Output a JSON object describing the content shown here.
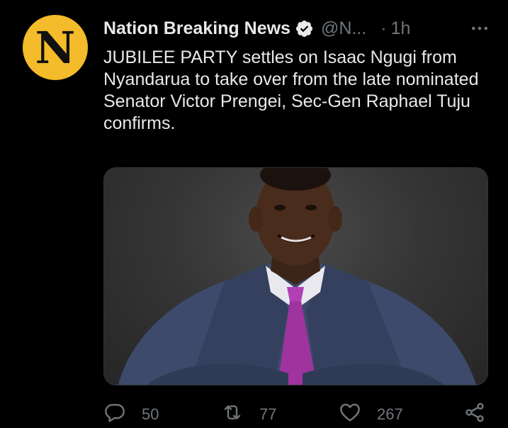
{
  "tweet": {
    "avatar_letter": "N",
    "display_name": "Nation Breaking News",
    "handle": "@N...",
    "dot": "·",
    "time": "1h",
    "text": "JUBILEE PARTY settles on Isaac Ngugi from Nyandarua to take over from the late nominated Senator Victor Prengei, Sec-Gen Raphael Tuju confirms.",
    "media_icon": "photo-of-man-in-suit",
    "stats": {
      "replies": "50",
      "retweets": "77",
      "likes": "267"
    }
  },
  "colors": {
    "background": "#000000",
    "text": "#e7e9ea",
    "secondary": "#71767b",
    "avatar": "#f4bb2a",
    "verified": "#e7e9ea"
  },
  "icons": {
    "verified": "verified-badge-icon",
    "more": "more-options-icon",
    "reply": "reply-icon",
    "retweet": "retweet-icon",
    "like": "heart-icon",
    "share": "share-icon"
  }
}
